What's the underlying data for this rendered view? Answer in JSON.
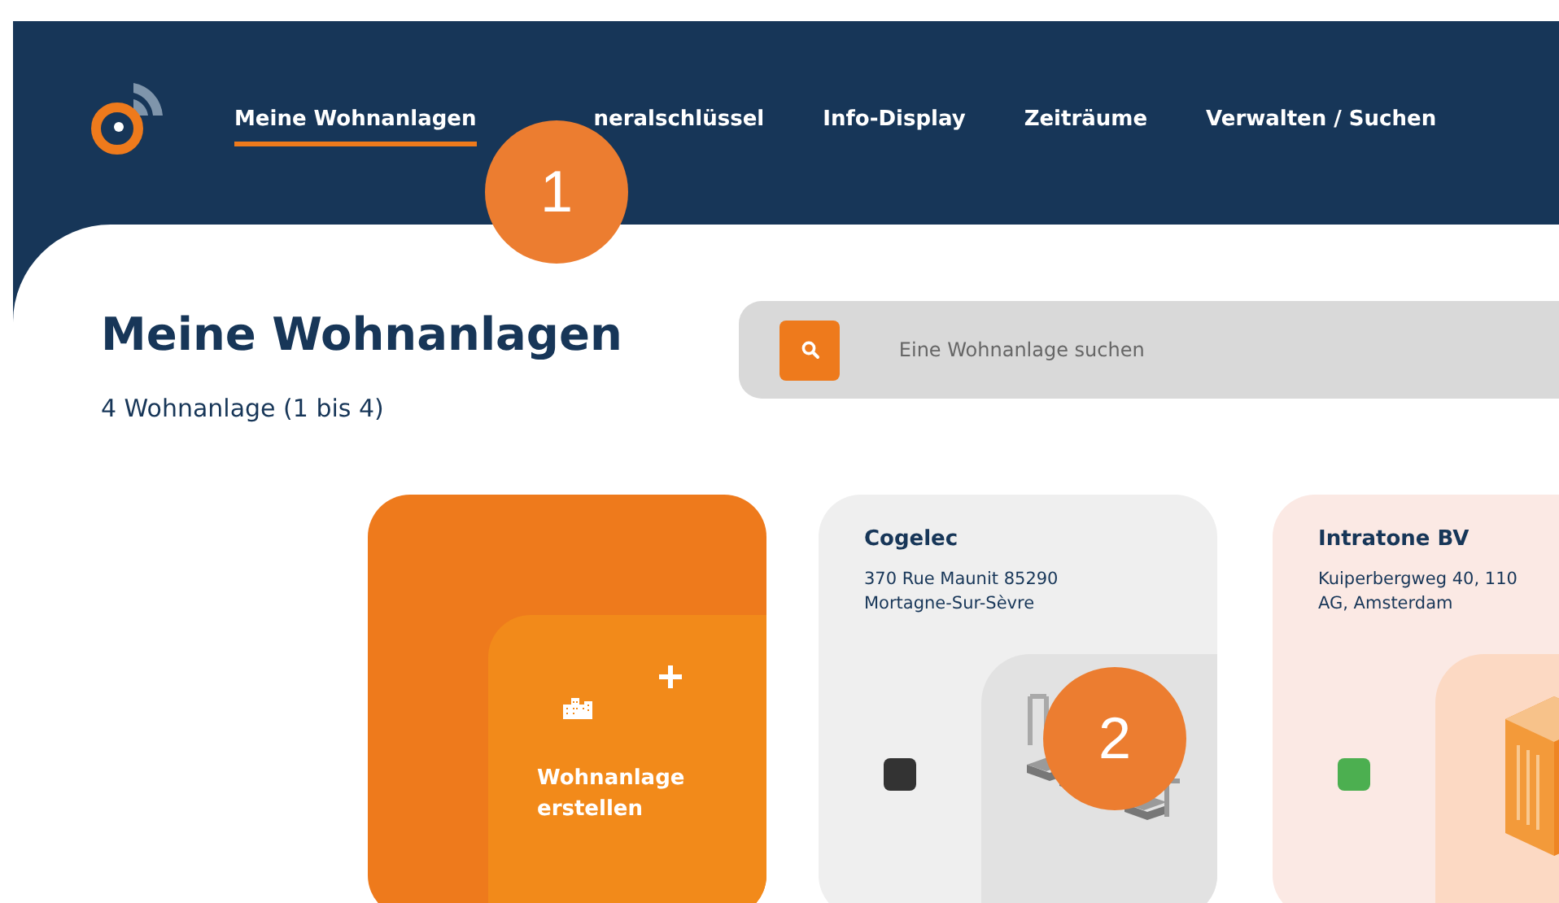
{
  "nav": {
    "items": [
      {
        "label": "Meine Wohnanlagen",
        "selected": true
      },
      {
        "label": "neralschlüssel",
        "selected": false
      },
      {
        "label": "Info-Display",
        "selected": false
      },
      {
        "label": "Zeiträume",
        "selected": false
      },
      {
        "label": "Verwalten / Suchen",
        "selected": false
      }
    ]
  },
  "page": {
    "title": "Meine Wohnanlagen",
    "count": "4 Wohnanlage (1 bis 4)"
  },
  "search": {
    "placeholder": "Eine Wohnanlage suchen"
  },
  "cards": [
    {
      "kind": "create",
      "label": "Wohnanlage erstellen"
    },
    {
      "kind": "parking",
      "name": "Cogelec",
      "address": "370 Rue Maunit 85290 Mortagne-Sur-Sèvre",
      "color": "#333333"
    },
    {
      "kind": "building",
      "name": "Intratone BV",
      "address": "Kuiperbergweg 40, 110",
      "address_2": "AG, Amsterdam",
      "color": "#4caf50"
    }
  ],
  "callouts": [
    {
      "label": "1"
    },
    {
      "label": "2"
    }
  ]
}
